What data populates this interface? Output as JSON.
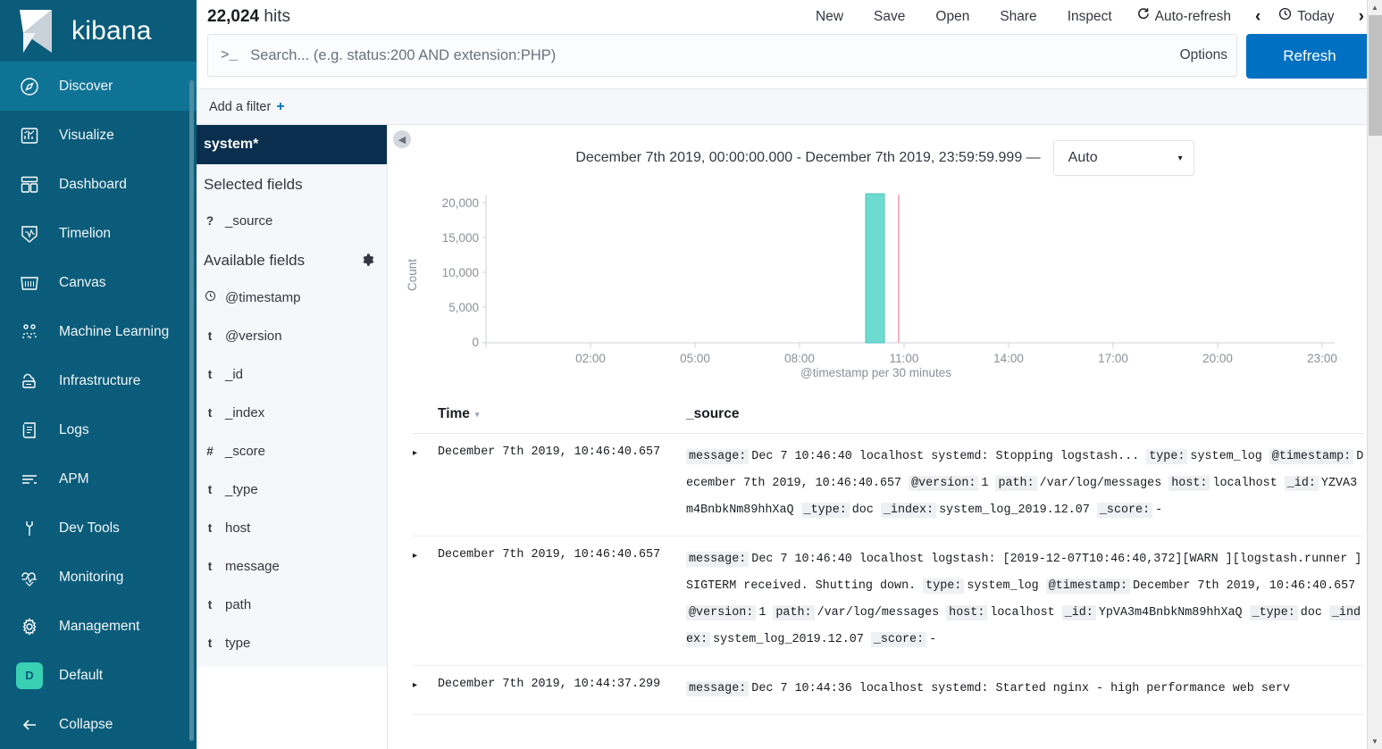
{
  "sidebar": {
    "brand": "kibana",
    "items": [
      {
        "label": "Discover",
        "icon": "compass-icon",
        "active": true
      },
      {
        "label": "Visualize",
        "icon": "chart-icon",
        "active": false
      },
      {
        "label": "Dashboard",
        "icon": "dashboard-icon",
        "active": false
      },
      {
        "label": "Timelion",
        "icon": "timelion-icon",
        "active": false
      },
      {
        "label": "Canvas",
        "icon": "canvas-icon",
        "active": false
      },
      {
        "label": "Machine Learning",
        "icon": "machine-learning-icon",
        "active": false
      },
      {
        "label": "Infrastructure",
        "icon": "infrastructure-icon",
        "active": false
      },
      {
        "label": "Logs",
        "icon": "logs-icon",
        "active": false
      },
      {
        "label": "APM",
        "icon": "apm-icon",
        "active": false
      },
      {
        "label": "Dev Tools",
        "icon": "wrench-icon",
        "active": false
      },
      {
        "label": "Monitoring",
        "icon": "heartbeat-icon",
        "active": false
      },
      {
        "label": "Management",
        "icon": "gear-icon",
        "active": false
      }
    ],
    "space": {
      "label": "Default",
      "initial": "D"
    },
    "collapse": {
      "label": "Collapse",
      "icon": "arrow-left-icon"
    },
    "colors": {
      "bg": "#0a5c7a",
      "active": "#0f7396",
      "space_badge": "#39d0b3"
    }
  },
  "topbar": {
    "hits_count": "22,024",
    "hits_label": "hits",
    "menu": [
      {
        "label": "New",
        "name": "new"
      },
      {
        "label": "Save",
        "name": "save"
      },
      {
        "label": "Open",
        "name": "open"
      },
      {
        "label": "Share",
        "name": "share"
      },
      {
        "label": "Inspect",
        "name": "inspect"
      },
      {
        "label": "Auto-refresh",
        "name": "auto-refresh",
        "icon": "refresh-cycle-icon"
      }
    ],
    "time_picker": {
      "label": "Today",
      "icon": "clock-icon",
      "prev": "‹",
      "next": "›"
    }
  },
  "search": {
    "prompt": ">_",
    "value": "",
    "placeholder": "Search... (e.g. status:200 AND extension:PHP)",
    "options_label": "Options",
    "refresh_label": "Refresh",
    "refresh_color": "#0071c2"
  },
  "filters": {
    "add_label": "Add a filter",
    "add_glyph": "+"
  },
  "fields_panel": {
    "index_pattern": "system*",
    "selected_heading": "Selected fields",
    "selected": [
      {
        "type": "?",
        "name": "_source"
      }
    ],
    "available_heading": "Available fields",
    "available": [
      {
        "type": "⊕",
        "name": "@timestamp",
        "kind": "date"
      },
      {
        "type": "t",
        "name": "@version",
        "kind": "string"
      },
      {
        "type": "t",
        "name": "_id",
        "kind": "string"
      },
      {
        "type": "t",
        "name": "_index",
        "kind": "string"
      },
      {
        "type": "#",
        "name": "_score",
        "kind": "number"
      },
      {
        "type": "t",
        "name": "_type",
        "kind": "string"
      },
      {
        "type": "t",
        "name": "host",
        "kind": "string"
      },
      {
        "type": "t",
        "name": "message",
        "kind": "string"
      },
      {
        "type": "t",
        "name": "path",
        "kind": "string"
      },
      {
        "type": "t",
        "name": "type",
        "kind": "string"
      }
    ]
  },
  "chart_header": {
    "range": "December 7th 2019, 00:00:00.000 - December 7th 2019, 23:59:59.999 —",
    "interval_value": "Auto",
    "interval_caret": "▾",
    "collapse_icon": "chevron-left-circle-icon"
  },
  "chart_data": {
    "type": "bar",
    "title": "",
    "xlabel": "@timestamp per 30 minutes",
    "ylabel": "Count",
    "ylim": [
      0,
      22000
    ],
    "yticks": [
      0,
      5000,
      10000,
      15000,
      20000
    ],
    "ytick_labels": [
      "0",
      "5,000",
      "10,000",
      "15,000",
      "20,000"
    ],
    "xticks": [
      "02:00",
      "05:00",
      "08:00",
      "11:00",
      "14:00",
      "17:00",
      "20:00",
      "23:00"
    ],
    "x_domain_hours": [
      0,
      24
    ],
    "grid": false,
    "legend": "none",
    "bar_color": "#6edbd0",
    "bar_stroke": "#42bfb3",
    "marker_color": "#f2b4bd",
    "bars": [
      {
        "x": "10:00",
        "hour": 10.0,
        "value": 21800,
        "width_hours": 0.5
      }
    ],
    "markers": [
      {
        "hour": 10.95,
        "label": "current-time-marker"
      }
    ]
  },
  "doc_table": {
    "columns": [
      {
        "label": "Time",
        "name": "time",
        "sorted": true,
        "sort_caret": "▾"
      },
      {
        "label": "_source",
        "name": "source"
      }
    ],
    "rows": [
      {
        "caret": "▸",
        "time": "December 7th 2019, 10:46:40.657",
        "pairs": [
          {
            "key": "message:",
            "value": "Dec 7 10:46:40 localhost systemd: Stopping logstash..."
          },
          {
            "key": "type:",
            "value": "system_log"
          },
          {
            "key": "@timestamp:",
            "value": "December 7th 2019, 10:46:40.657"
          },
          {
            "key": "@version:",
            "value": "1"
          },
          {
            "key": "path:",
            "value": "/var/log/messages"
          },
          {
            "key": "host:",
            "value": "localhost"
          },
          {
            "key": "_id:",
            "value": "YZVA3m4BnbkNm89hhXaQ"
          },
          {
            "key": "_type:",
            "value": "doc"
          },
          {
            "key": "_index:",
            "value": "system_log_2019.12.07"
          },
          {
            "key": "_score:",
            "value": "-"
          }
        ]
      },
      {
        "caret": "▸",
        "time": "December 7th 2019, 10:46:40.657",
        "pairs": [
          {
            "key": "message:",
            "value": "Dec 7 10:46:40 localhost logstash: [2019-12-07T10:46:40,372][WARN ][logstash.runner ] SIGTERM received. Shutting down."
          },
          {
            "key": "type:",
            "value": "system_log"
          },
          {
            "key": "@timestamp:",
            "value": "December 7th 2019, 10:46:40.657"
          },
          {
            "key": "@version:",
            "value": "1"
          },
          {
            "key": "path:",
            "value": "/var/log/messages"
          },
          {
            "key": "host:",
            "value": "localhost"
          },
          {
            "key": "_id:",
            "value": "YpVA3m4BnbkNm89hhXaQ"
          },
          {
            "key": "_type:",
            "value": "doc"
          },
          {
            "key": "_index:",
            "value": "system_log_2019.12.07"
          },
          {
            "key": "_score:",
            "value": "-"
          }
        ]
      },
      {
        "caret": "▸",
        "time": "December 7th 2019, 10:44:37.299",
        "pairs": [
          {
            "key": "message:",
            "value": "Dec 7 10:44:36 localhost systemd: Started nginx - high performance web serv"
          }
        ]
      }
    ]
  },
  "scrollbar": {
    "up": "▲",
    "down": "▼"
  }
}
